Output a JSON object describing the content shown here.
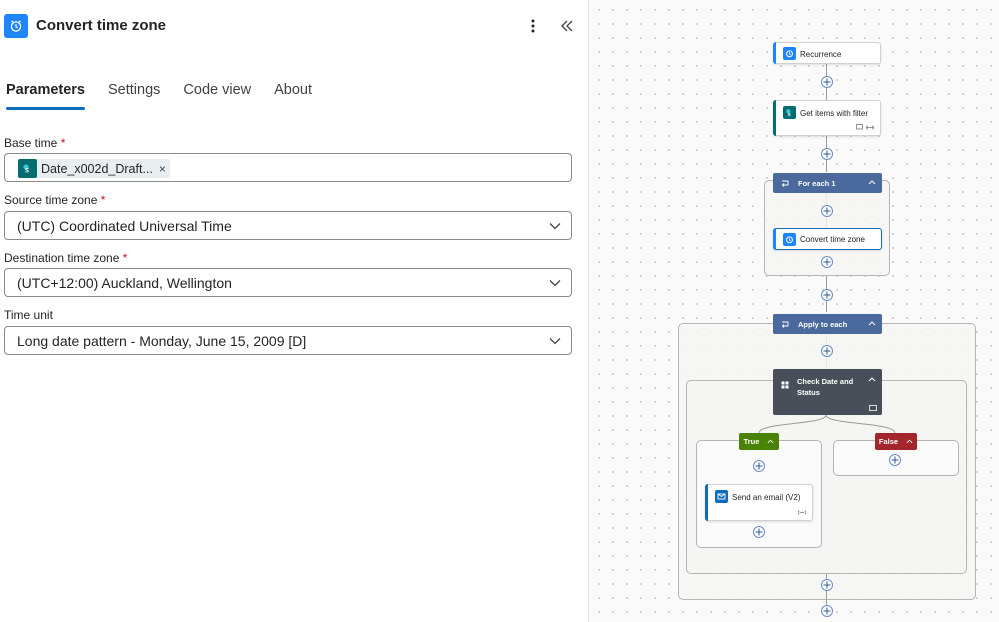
{
  "panel": {
    "title": "Convert time zone",
    "icon": "alarm-clock-icon",
    "more_icon": "more-vertical-icon",
    "collapse_icon": "double-chevron-left-icon",
    "tabs": [
      {
        "label": "Parameters",
        "active": true
      },
      {
        "label": "Settings",
        "active": false
      },
      {
        "label": "Code view",
        "active": false
      },
      {
        "label": "About",
        "active": false
      }
    ],
    "fields": {
      "base_time": {
        "label": "Base time",
        "required_mark": "*",
        "token_text": "Date_x002d_Draft...",
        "token_icon": "sharepoint-icon",
        "token_remove": "×"
      },
      "source_tz": {
        "label": "Source time zone",
        "required_mark": "*",
        "value": "(UTC) Coordinated Universal Time"
      },
      "dest_tz": {
        "label": "Destination time zone",
        "required_mark": "*",
        "value": "(UTC+12:00) Auckland, Wellington"
      },
      "time_unit": {
        "label": "Time unit",
        "value": "Long date pattern - Monday, June 15, 2009 [D]"
      }
    }
  },
  "canvas": {
    "nodes": {
      "recurrence": "Recurrence",
      "get_items": "Get items with filter",
      "for_each": "For each 1",
      "convert_tz": "Convert time zone",
      "apply_to_each": "Apply to each",
      "condition": "Check Date and Status",
      "true_branch": "True",
      "false_branch": "False",
      "send_email": "Send an email (V2)"
    },
    "colors": {
      "loop_header": "#4a6a9e",
      "condition_header": "#484f58",
      "true_branch": "#498205",
      "false_branch": "#a4262c",
      "sharepoint": "#036c70",
      "schedule": "#1f85ff",
      "outlook": "#0f6cbd"
    }
  }
}
